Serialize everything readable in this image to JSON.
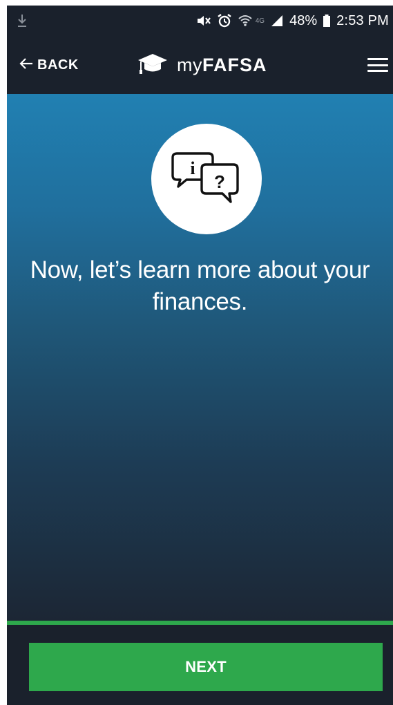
{
  "status_bar": {
    "time": "2:53 PM",
    "battery_percent": "48%",
    "network": "4G",
    "icons": [
      "download-icon",
      "mute-icon",
      "alarm-icon",
      "wifi-icon",
      "signal-icon",
      "battery-icon"
    ]
  },
  "header": {
    "back_label": "BACK",
    "brand_prefix": "my",
    "brand_bold": "FAFSA",
    "icons": [
      "back-arrow-icon",
      "graduation-cap-icon",
      "hamburger-menu-icon"
    ]
  },
  "main": {
    "illustration": "info-question-chat-icon",
    "headline": "Now, let’s learn more about your finances."
  },
  "progress": {
    "value": 1.0
  },
  "footer": {
    "next_label": "NEXT"
  },
  "colors": {
    "header_bg": "#1a212c",
    "gradient_top": "#2180b2",
    "gradient_bottom": "#1c2634",
    "accent_green": "#2ea84c",
    "text": "#ffffff"
  }
}
